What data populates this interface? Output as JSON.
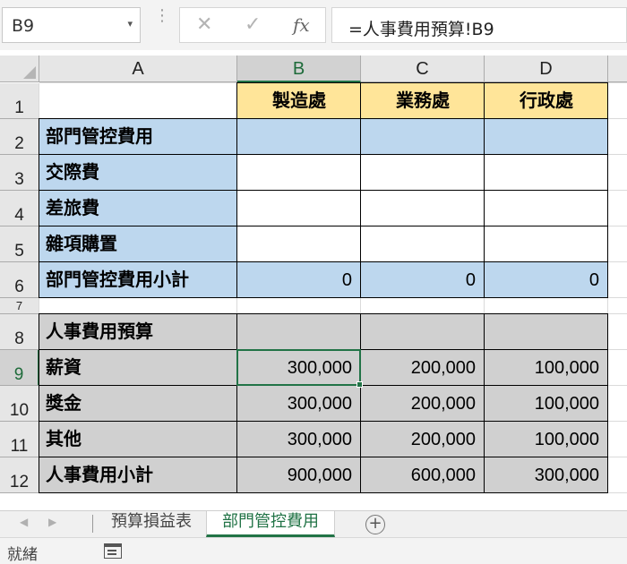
{
  "name_box": {
    "value": "B9"
  },
  "formula_bar": {
    "formula": "=人事費用預算!B9",
    "fx_label": "fx",
    "cancel_icon": "x-icon",
    "enter_icon": "check-icon"
  },
  "columns": [
    "A",
    "B",
    "C",
    "D"
  ],
  "rows": [
    "1",
    "2",
    "3",
    "4",
    "5",
    "6",
    "7",
    "8",
    "9",
    "10",
    "11",
    "12"
  ],
  "cells": {
    "B1": "製造處",
    "C1": "業務處",
    "D1": "行政處",
    "A2": "部門管控費用",
    "A3": "交際費",
    "A4": "差旅費",
    "A5": "雜項購置",
    "A6": "部門管控費用小計",
    "B6": "0",
    "C6": "0",
    "D6": "0",
    "A8": "人事費用預算",
    "A9": "薪資",
    "B9": "300,000",
    "C9": "200,000",
    "D9": "100,000",
    "A10": "獎金",
    "B10": "300,000",
    "C10": "200,000",
    "D10": "100,000",
    "A11": "其他",
    "B11": "300,000",
    "C11": "200,000",
    "D11": "100,000",
    "A12": "人事費用小計",
    "B12": "900,000",
    "C12": "600,000",
    "D12": "300,000"
  },
  "selected_cell": "B9",
  "sheet_tabs": [
    {
      "label": "預算損益表",
      "active": false
    },
    {
      "label": "部門管控費用",
      "active": true
    }
  ],
  "status": {
    "ready": "就緒"
  },
  "colors": {
    "header_yellow": "#ffe599",
    "section_blue": "#bdd7ee",
    "section_gray": "#d0d0d0",
    "excel_green": "#217346"
  }
}
